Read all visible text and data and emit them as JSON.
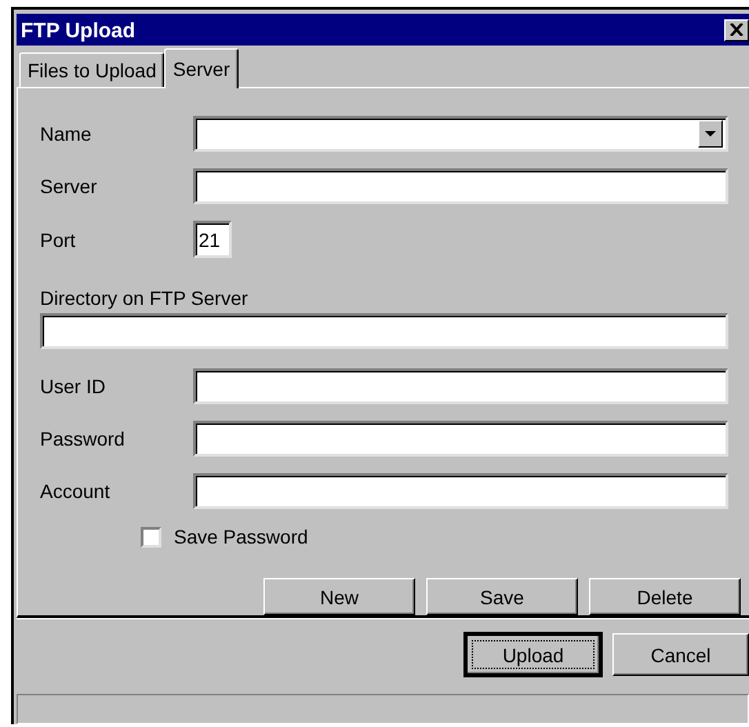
{
  "window": {
    "title": "FTP Upload"
  },
  "tabs": [
    {
      "label": "Files to Upload",
      "selected": false
    },
    {
      "label": "Server",
      "selected": true
    }
  ],
  "fields": [
    {
      "label": "Name",
      "kind": "combo"
    },
    {
      "label": "Server",
      "kind": "text"
    },
    {
      "label": "Port",
      "kind": "short",
      "value": "21"
    },
    {
      "label": "Directory on FTP Server",
      "kind": "wide"
    },
    {
      "label": "User ID",
      "kind": "text"
    },
    {
      "label": "Password",
      "kind": "text"
    },
    {
      "label": "Account",
      "kind": "text"
    }
  ],
  "save_password": {
    "label": "Save Password",
    "checked": false
  },
  "profile_buttons": [
    "New",
    "Save",
    "Delete"
  ],
  "dialog_buttons": [
    {
      "label": "Upload",
      "default": true
    },
    {
      "label": "Cancel",
      "default": false
    }
  ]
}
